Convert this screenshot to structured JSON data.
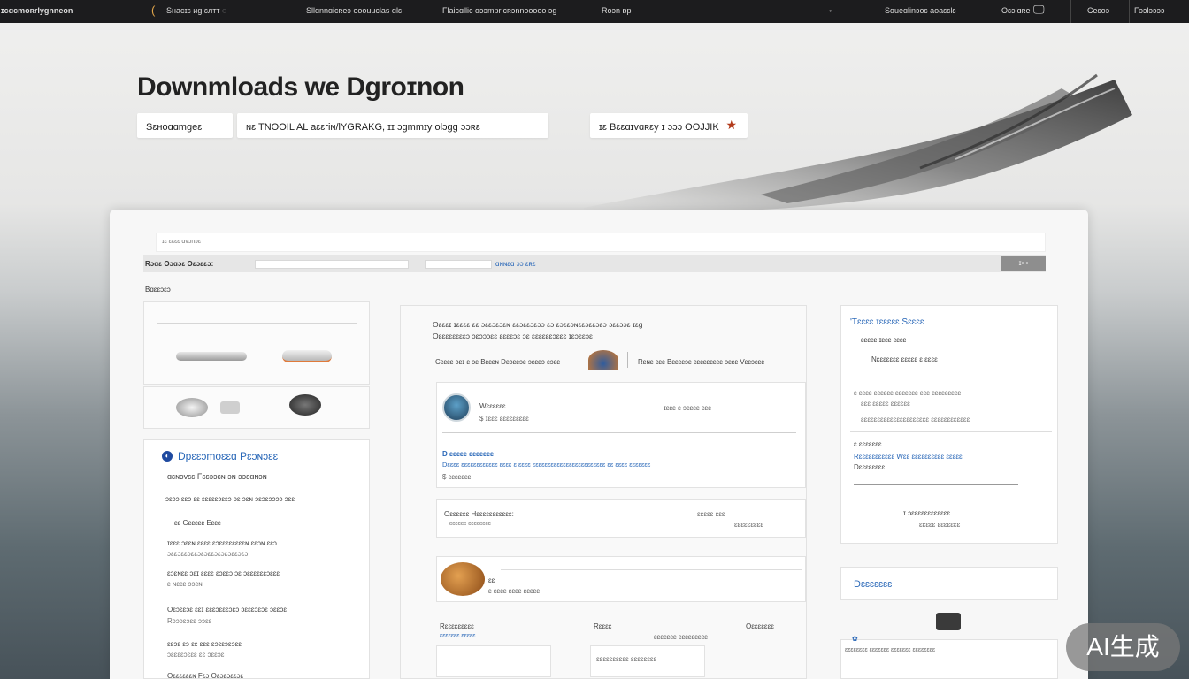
{
  "nav": {
    "logo": "ɪcɑcmoʀrlyɡnneon",
    "item1": "Sнасɪɛ иɡ ɛлтт ◌",
    "item2": "Sllɑnnɑicʀeɔ eoouuclas ɑlɛ",
    "item3": "Flaicɑllic ɑɔɔmpricʀɔnnooooo ɔɡ",
    "item4": "Roɔn ɒp",
    "item5": "Sɑueɑlinɔoɛ aoaɛɛlɛ",
    "item6": "Oɛɔlɑʀe",
    "item7": "Ceɛoɔ",
    "item8": "Fɔɔlɔɔɔɔ"
  },
  "hero": {
    "title": "Downmloads we Dgroɪnon",
    "pill1": "Sɛнoɑɑmgeɛl",
    "pill2": "ɴɛ  TNOOIL AL aɛɛɾiɴ/lYGRAKG, ɪɪ ɔɡmmɪy olɔɡɡ ɔɔʀɛ",
    "pill3": "ɪɛ Bɛɛɑɪvɑʀɛy ɪ ɔɔɔ OOJJIK"
  },
  "toolbar": {
    "breadcrumb": "ɪɛ ɛɛɛɛ ɑvɔnɔɛ",
    "label": "Rɔɑɛ Oɔɑɔɛ Oɛɔɛɛɔ:",
    "link": "ɑɴɴɛɑ ɔɔ ɛʀɛ",
    "btn": "ɪ▪ ▪"
  },
  "left": {
    "section": "Bɑɛɛɔɛɔ",
    "heading": "Dpɛɛɔmoɛɛɑ Pɛɔɴɔɛɛ",
    "lines": [
      "ɑɛɴɔvɛɛ Fɛɛɔɔɛɴ ɔɴ ɔɔɛɑɴɔɴ",
      "ɔɛɔɔ ɛɛɔ ɛɛ ɛɛɛɛɛɔɛɛɔ ɔɛ ɔɛɴ ɔɛɔɛɔɔɔɔ ɔɛɛ",
      "ɛɛ Gɛɛɛɛɛ Eɛɛɛ",
      "ɪɛɛɛ ɔɛɛɴ ɛɛɛɛ ɛɔɛɛɛɛɛɛɛɛɴ ɛɛɔɴ  ɛɛɔ",
      "ɔɛɛɔɛɛɔɛɛɔɛɔɛɛɔɛɔɛɔɛɛɔɛɔ",
      "ɛɔɛɴɛɛ ɔɛɪ ɛɛɛɛ ɛɔɛɛɔ ɔɛ ɔɛɛɛɛɛɛɔɛɛɛ",
      "ɛ ɴɛɛɛ ɔɔɛɴ",
      "Oɛɔɛɛɔɛ ɛɛɪ ɛɛɛɔɛɛɛɔɛɔ ɔɛɛɛɔɛɔɛ ɔɛɛɔɛ",
      "Rɔɔɔɛɔɛɛ ɔɔɛɛ",
      "ɛɛɔɛ ɛɔ ɛɛ ɛɛɛ ɛɔɛɛɔɛɔɛɛ",
      "ɔɛɛɛɛɔɛɛɛ ɛɛ ɔɛɛɔɛ",
      "Oɛɛɛɛɛɛɴ Fɛɔ Oɛɔɛɔɛɛɔɛ"
    ]
  },
  "center": {
    "intro1": "Oɛɛɛɪ ɪɛɛɛɛ ɛɛ ɔɛɛɔɛɔɛɴ ɛɛɔɛɛɔɛɔɔ ɛɔ ɛɔɛɛɔɴɛɛɔɛɛɔɛɔ ɔɛɛɔɔɛ ɪɛɡ",
    "intro2": "Oɛɛɛɛɛɛɛɛɔ ɔɛɔɔɔɛɛ ɛɛɛɛɔɛ ɔɛ ɛɛɛɛɛɛɔɛɛɛ ɪɛɔɛɛɔɛ",
    "cap1": "Cɛɛɛɛ ɔɛɪ ɛ ɔɛ Bɛɛɛɴ Dɛɔɛɛɔɛ ɔɛɛɛɔ ɛɔɛɛ",
    "cap2": "Rɛɴɛ ɛɛɛ Bɛɛɛɛɔɛ ɛɛɛɛɛɛɛɛɛ ɔɛɛɛ Vɛɛɔɛɛɛ",
    "row1a": "Wɛɛɛɛɛɛ",
    "row1b": "$ ɪɛɛɛ ɛɛɛɛɛɛɛɛɛ",
    "row1c": "ɪɛɛɛ ɛ ɔɛɛɛɛ ɛɛɛ",
    "row2a": "D ɛɛɛɛɛ ɛɛɛɛɛɛɛ",
    "row2b": "Dɛɛɛɛ ɛɛɛɛɛɛɛɛɛɛɛɛ ɛɛɛɛ ɛ ɛɛɛɛ ɛɛɛɛɛɛɛɛɛɛɛɛɛɛɛɛɛɛɛɛɛɛɛɛ ɛɛ ɛɛɛɛ ɛɛɛɛɛɛɛ",
    "row2c": "$ ɛɛɛɛɛɛɛ",
    "row3a": "Oɛɛɛɛɛɛ Hɛɛɛɛɛɛɛɛɛɛɛ:",
    "row3b": "ɛɛɛɛɛɛ ɛɛɛɛɛɛɛɛ",
    "row3c": "ɛɛɛɛɛ ɛɛɛ",
    "row3d": "ɛɛɛɛɛɛɛɛɛ",
    "row4a": "ɛɛ",
    "row4b": "ɛ ɛɛɛɛ ɛɛɛɛ ɛɛɛɛɛ",
    "b1": "Rɛɛɛɛɛɛɛɛɛ",
    "b2": "Rɛɛɛɛ",
    "b3": "Oɛɛɛɛɛɛɛ",
    "b4": "ɛɛɛɛɛɛɛ ɛɛɛɛɛ",
    "b5": "ɛɛɛɛɛɛɛ ɛɛɛɛɛɛɛɛɛ",
    "b6": "ɛɛɛɛɛɛɛɛɛɛ ɛɛɛɛɛɛɛɛ"
  },
  "right": {
    "heading": "'Tɛɛɛɛ ɪɛɛɛɛɛ Sɛɛɛɛ",
    "l1": "ɛɛɛɛɛ ɪɛɛɛ ɛɛɛɛ",
    "l2": "Nɛɛɛɛɛɛɛ ɛɛɛɛɛ ɛ ɛɛɛɛ",
    "l3": "ɛ ɛɛɛɛ ɛɛɛɛɛɛ ɛɛɛɛɛɛɛ ɛɛɛ ɛɛɛɛɛɛɛɛɛ",
    "l4": "ɛɛɛ ɛɛɛɛɛ ɛɛɛɛɛɛ",
    "l5": "ɛɛɛɛɛɛɛɛɛɛɛɛɛɛɛɛɛɛɛɛɛ ɛɛɛɛɛɛɛɛɛɛɛɛ",
    "l6": "ɛ ɛɛɛɛɛɛɛ",
    "l7": "Rɛɛɛɛɛɛɛɛɛɛɛ Wɛɛ ɛɛɛɛɛɛɛɛɛɛ ɛɛɛɛɛ",
    "l8": "Dɛɛɛɛɛɛɛɛ",
    "l9": "ɪ ɔɛɛɛɛɛɛɛɛɛɛɛɛ",
    "l10": "ɛɛɛɛɛ ɛɛɛɛɛɛɛ",
    "downloads": "Dɛɛɛɛɛɛɛ",
    "d1": "ɛɛɛɛɛɛɛɛ ɛɛɛɛɛɛɛ ɛɛɛɛɛɛɛ ɛɛɛɛɛɛɛɛ"
  },
  "badge": "AI生成"
}
